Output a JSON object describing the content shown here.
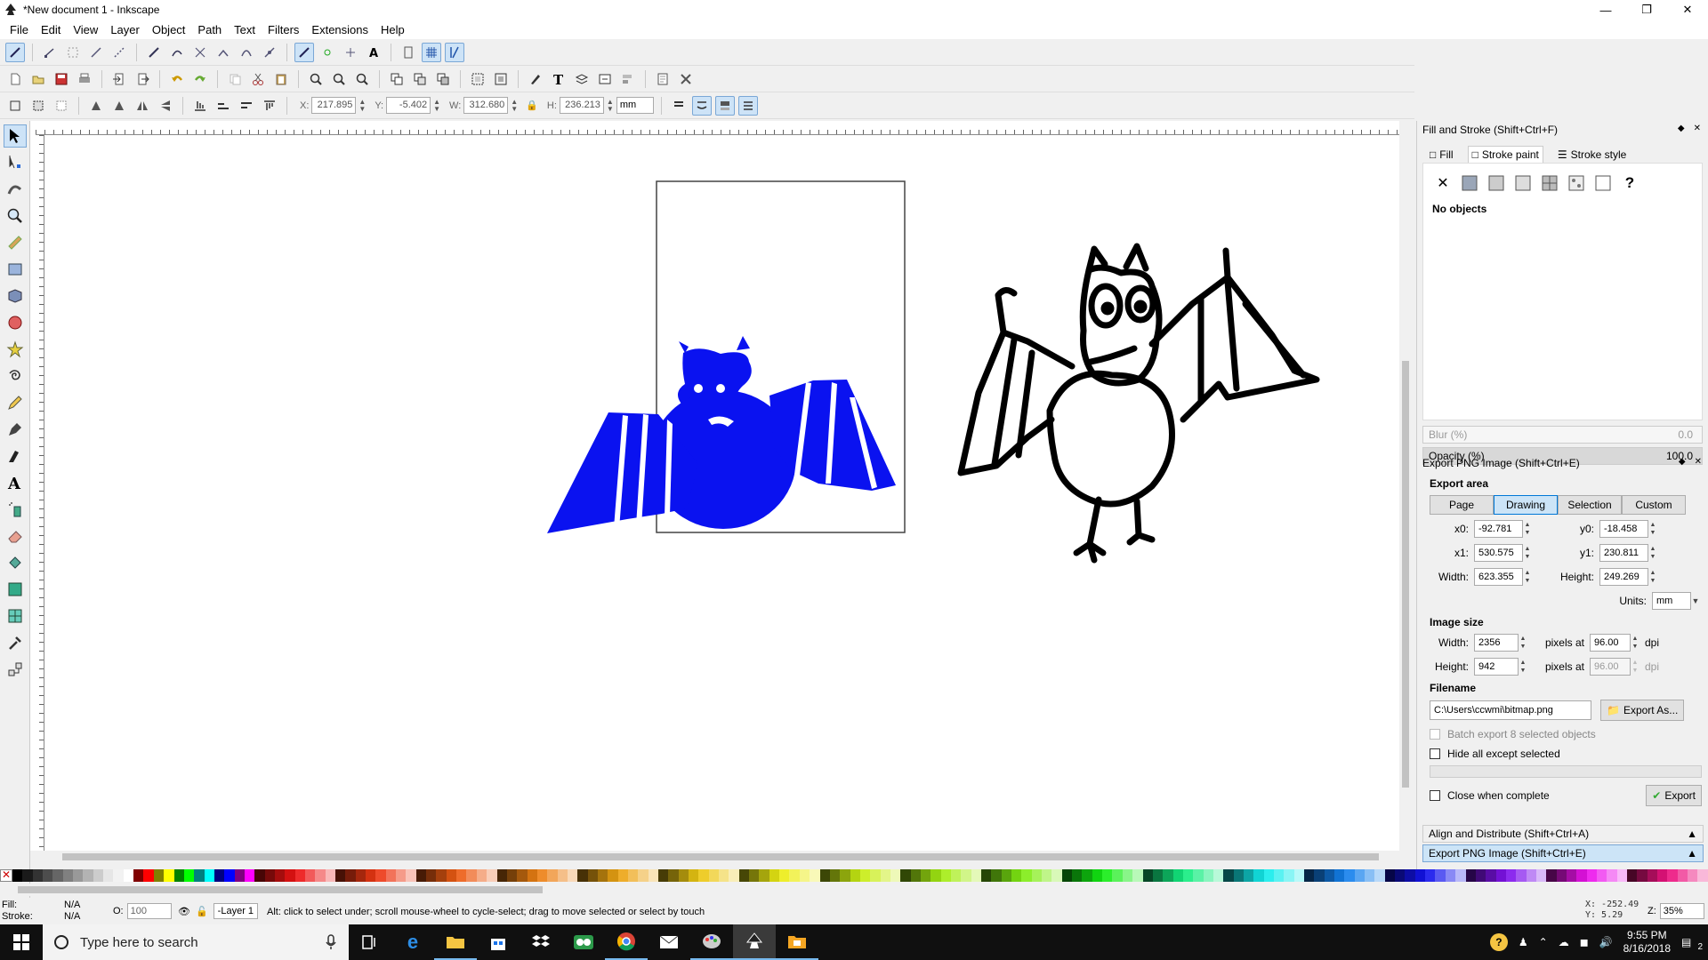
{
  "window": {
    "title": "*New document 1 - Inkscape"
  },
  "menu": [
    "File",
    "Edit",
    "View",
    "Layer",
    "Object",
    "Path",
    "Text",
    "Filters",
    "Extensions",
    "Help"
  ],
  "coords": {
    "x_label": "X:",
    "x": "217.895",
    "y_label": "Y:",
    "y": "-5.402",
    "w_label": "W:",
    "w": "312.680",
    "h_label": "H:",
    "h": "236.213",
    "unit": "mm"
  },
  "fill_stroke": {
    "title": "Fill and Stroke (Shift+Ctrl+F)",
    "tabs": [
      "Fill",
      "Stroke paint",
      "Stroke style"
    ],
    "no_objects": "No objects",
    "blur_label": "Blur (%)",
    "blur_value": "0.0",
    "opacity_label": "Opacity (%)",
    "opacity_value": "100.0"
  },
  "export": {
    "title": "Export PNG Image (Shift+Ctrl+E)",
    "area_heading": "Export area",
    "area_buttons": [
      "Page",
      "Drawing",
      "Selection",
      "Custom"
    ],
    "x0_label": "x0:",
    "x0": "-92.781",
    "y0_label": "y0:",
    "y0": "-18.458",
    "x1_label": "x1:",
    "x1": "530.575",
    "y1_label": "y1:",
    "y1": "230.811",
    "width_label": "Width:",
    "width": "623.355",
    "height_label": "Height:",
    "height": "249.269",
    "units_label": "Units:",
    "units": "mm",
    "image_size_heading": "Image size",
    "img_width_label": "Width:",
    "img_width": "2356",
    "img_height_label": "Height:",
    "img_height": "942",
    "pixels_at": "pixels at",
    "dpi1": "96.00",
    "dpi2": "96.00",
    "dpi_unit": "dpi",
    "filename_heading": "Filename",
    "filename": "C:\\Users\\ccwmi\\bitmap.png",
    "export_as": "Export As...",
    "batch_export": "Batch export 8 selected objects",
    "hide_all": "Hide all except selected",
    "close_when_complete": "Close when complete",
    "export_button": "Export"
  },
  "dock_bottom": {
    "align": "Align and Distribute (Shift+Ctrl+A)",
    "export": "Export PNG Image (Shift+Ctrl+E)"
  },
  "status": {
    "fill_label": "Fill:",
    "fill_value": "N/A",
    "stroke_label": "Stroke:",
    "stroke_value": "N/A",
    "opacity_label": "O:",
    "opacity_value": "100",
    "layer": "-Layer 1",
    "message": "Alt: click to select under; scroll mouse-wheel to cycle-select; drag to move selected or select by touch",
    "cursor_x": "X: -252.49",
    "cursor_y": "Y:   5.29",
    "zoom_label": "Z:",
    "zoom": "35%"
  },
  "taskbar": {
    "search_placeholder": "Type here to search",
    "time": "9:55 PM",
    "date": "8/16/2018",
    "notification_count": "2"
  },
  "colors": {
    "blue_bat": "#0a12f0",
    "selection_accent": "#cde3f7"
  }
}
